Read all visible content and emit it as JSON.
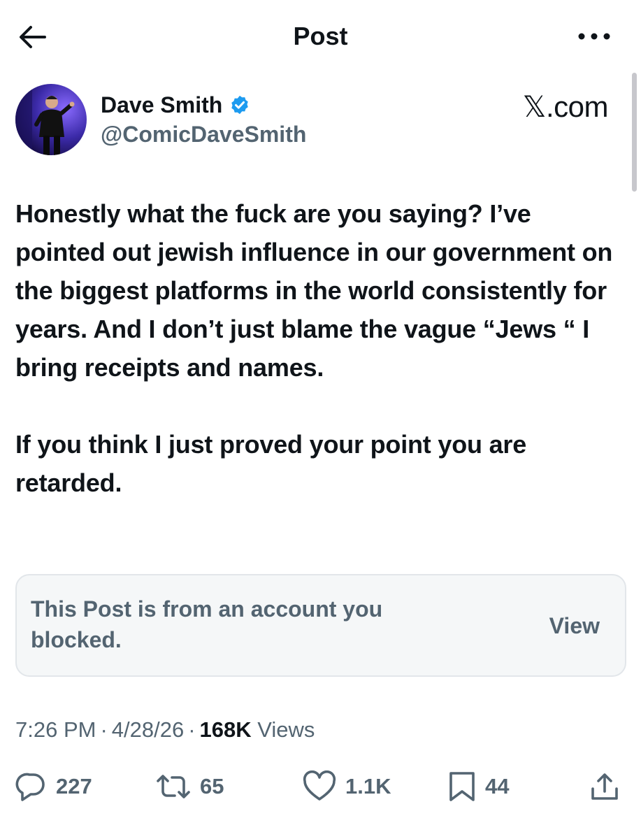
{
  "header": {
    "title": "Post",
    "back_icon": "arrow-left-icon",
    "more_icon": "more-horizontal-icon"
  },
  "author": {
    "display_name": "Dave Smith",
    "handle": "@ComicDaveSmith",
    "verified": true,
    "verified_color": "#1d9bf0"
  },
  "watermark": {
    "x_glyph": "𝕏",
    "suffix": ".com"
  },
  "post": {
    "paragraph_1": "Honestly what the fuck are you saying? I’ve pointed out jewish influence in our government on the biggest platforms in the world consistently for years. And I don’t just blame the vague “Jews “ I bring receipts and names.",
    "paragraph_2": "If you think I just proved your point you are retarded."
  },
  "blocked_notice": {
    "text": "This Post is from an account you blocked.",
    "view_label": "View"
  },
  "meta": {
    "time": "7:26 PM",
    "date": "4/28/26",
    "separator": "·",
    "views_count": "168K",
    "views_label": "Views"
  },
  "actions": {
    "replies": "227",
    "reposts": "65",
    "likes": "1.1K",
    "bookmarks": "44"
  },
  "colors": {
    "text_primary": "#0f1419",
    "text_secondary": "#536471",
    "card_bg": "#f5f7f8",
    "card_border": "#e2e6ea"
  }
}
